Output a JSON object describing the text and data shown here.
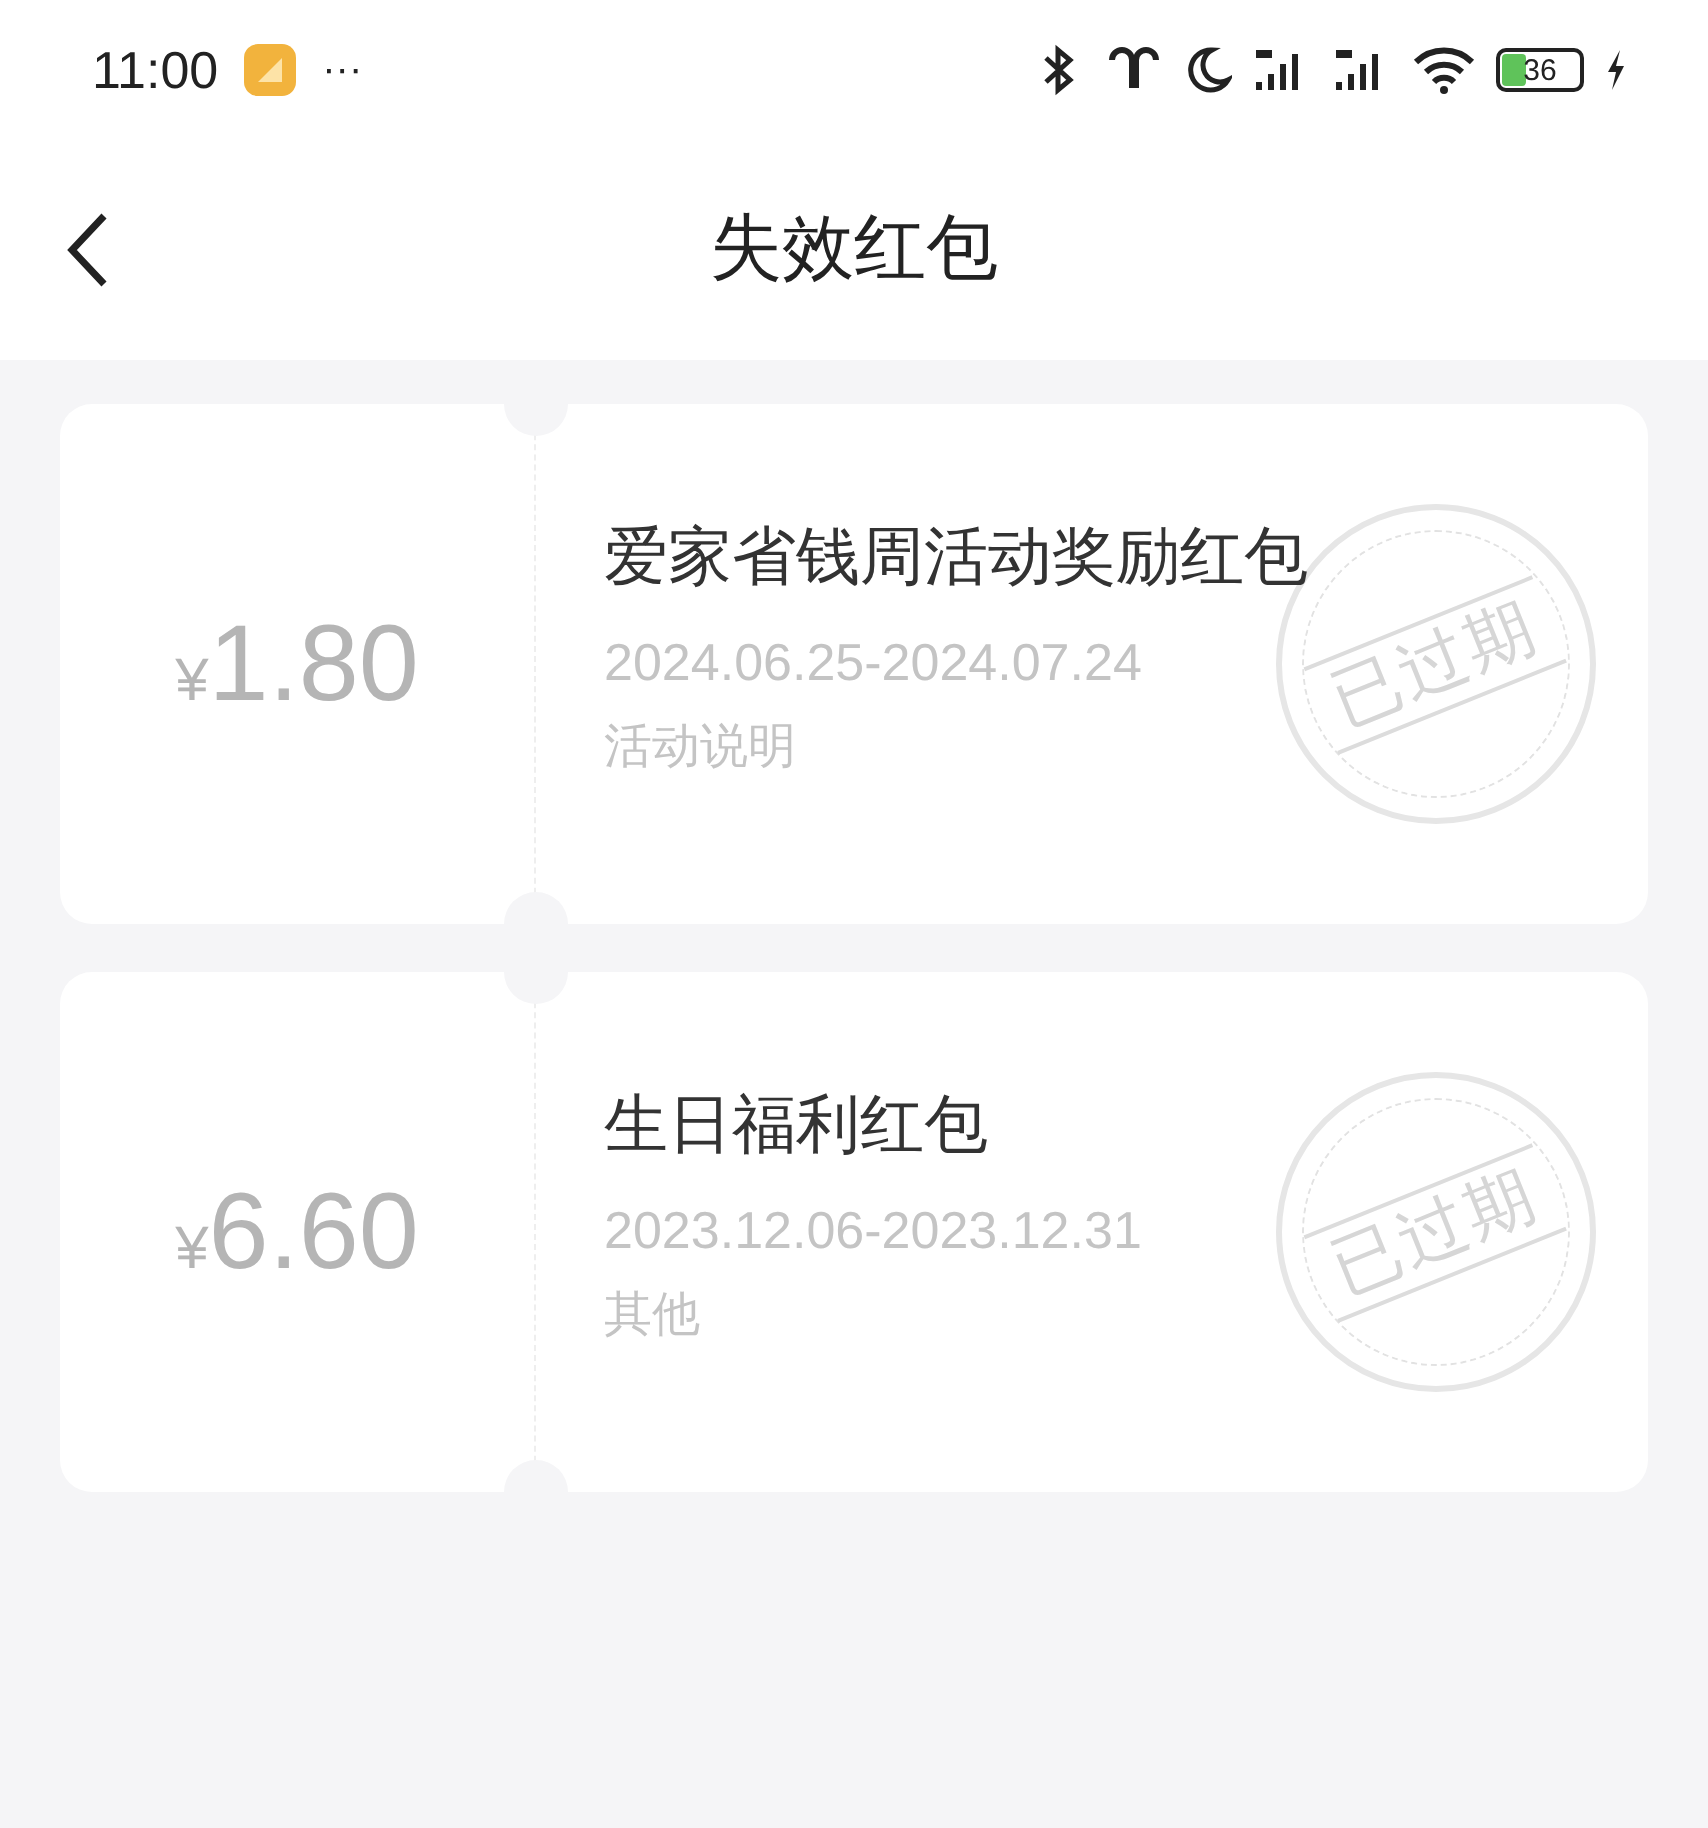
{
  "status_bar": {
    "time": "11:00",
    "more": "···",
    "battery": "36",
    "charging": true
  },
  "header": {
    "title": "失效红包"
  },
  "coupons": [
    {
      "amount": "1.80",
      "currency": "¥",
      "title": "爱家省钱周活动奖励红包",
      "period": "2024.06.25-2024.07.24",
      "note": "活动说明",
      "stamp": "已过期"
    },
    {
      "amount": "6.60",
      "currency": "¥",
      "title": "生日福利红包",
      "period": "2023.12.06-2023.12.31",
      "note": "其他",
      "stamp": "已过期"
    }
  ]
}
